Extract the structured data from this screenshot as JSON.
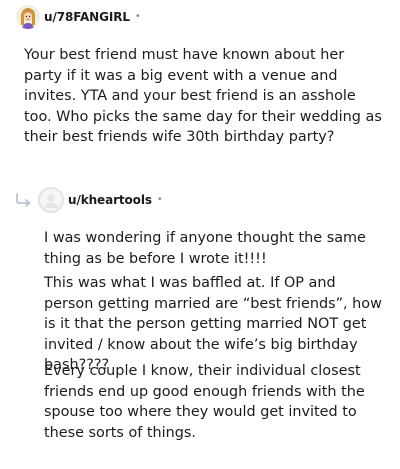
{
  "comments": [
    {
      "username": "u/78FANGIRL",
      "separator": "•",
      "avatar_icon": "girl-avatar-icon",
      "text": "Your best friend must have known about her party if it was a big event with a venue and invites. YTA and your best friend is an asshole too. Who picks the same day for their wedding as their best friends wife 30th birthday party?"
    },
    {
      "username": "u/kheartools",
      "separator": "•",
      "avatar_icon": "default-user-avatar-icon",
      "reply_icon": "reply-arrow-icon",
      "paragraphs": [
        "I was wondering if anyone thought the same thing as be before I wrote it!!!!",
        "This was what I was baffled at. If OP and person getting married are “best friends”, how is it that the person getting married NOT get invited / know about the wife’s big birthday bash????",
        "Every couple I know, their individual closest friends end up good enough friends with the spouse too where they would get invited to these sorts of things."
      ]
    }
  ],
  "colors": {
    "text": "#1c1c1c",
    "muted": "#8a8a8a",
    "reply_arrow": "#b8c4d2"
  }
}
